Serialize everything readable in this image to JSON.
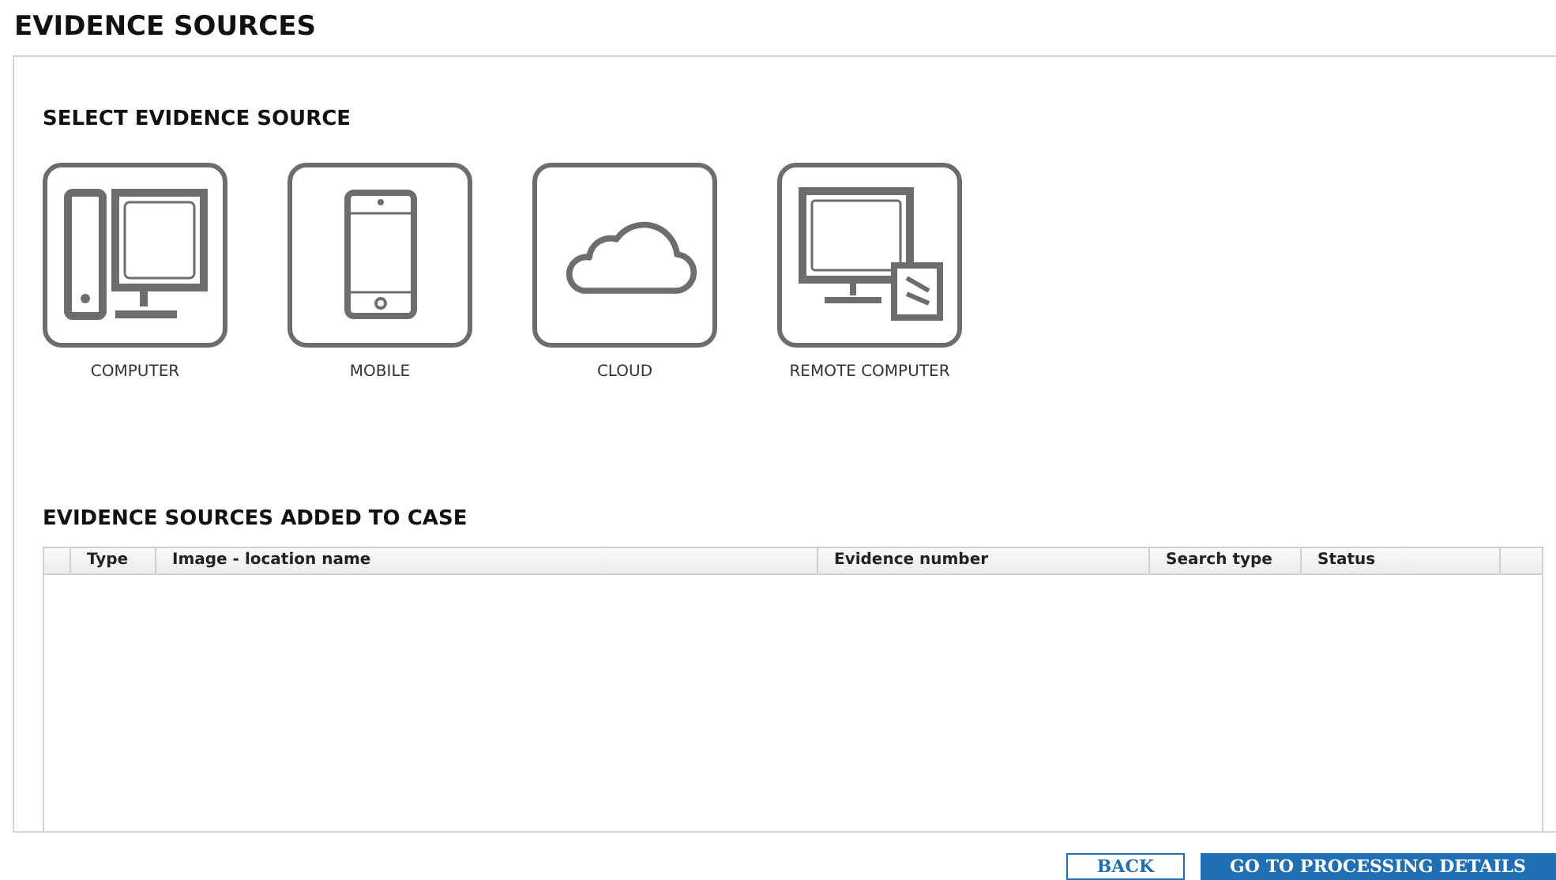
{
  "title": "EVIDENCE SOURCES",
  "select_section": {
    "heading": "SELECT EVIDENCE SOURCE",
    "sources": [
      {
        "kind": "computer",
        "label": "COMPUTER"
      },
      {
        "kind": "mobile",
        "label": "MOBILE"
      },
      {
        "kind": "cloud",
        "label": "CLOUD"
      },
      {
        "kind": "remote",
        "label": "REMOTE COMPUTER"
      }
    ]
  },
  "added_section": {
    "heading": "EVIDENCE SOURCES ADDED TO CASE",
    "table": {
      "columns": [
        "Type",
        "Image - location name",
        "Evidence number",
        "Search type",
        "Status"
      ]
    }
  },
  "buttons": [
    {
      "kind": "secondary",
      "label": "BACK"
    },
    {
      "kind": "primary",
      "label": "GO TO PROCESSING DETAILS"
    }
  ]
}
